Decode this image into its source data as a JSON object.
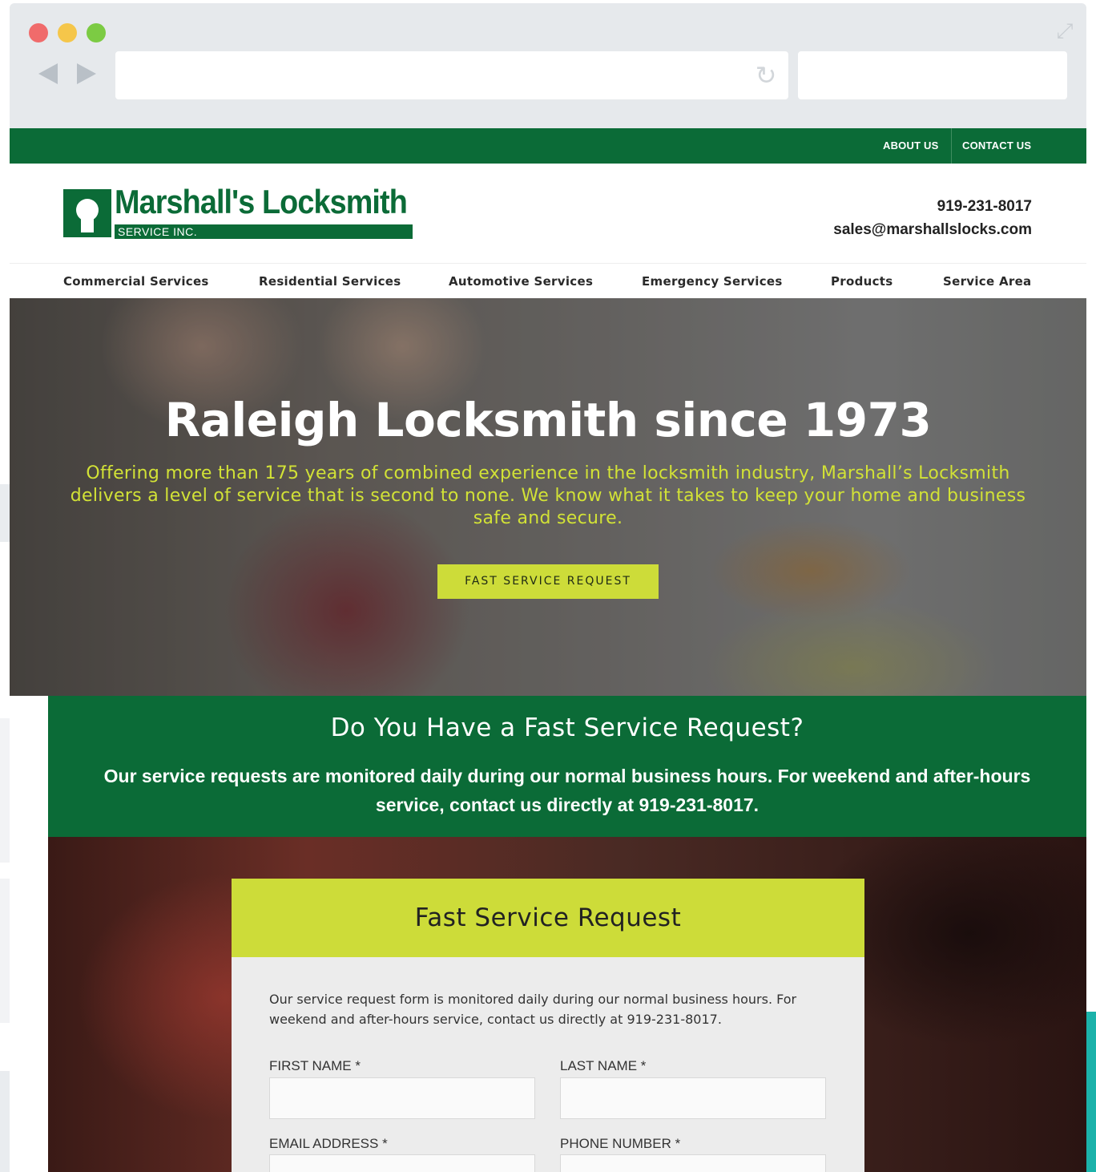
{
  "site": {
    "topbar": {
      "about": "ABOUT US",
      "contact": "CONTACT US"
    },
    "header": {
      "logo_name": "Marshall's Locksmith",
      "logo_sub": "SERVICE INC.",
      "phone": "919-231-8017",
      "email": "sales@marshallslocks.com"
    },
    "nav": [
      "Commercial Services",
      "Residential Services",
      "Automotive Services",
      "Emergency Services",
      "Products",
      "Service Area"
    ],
    "hero": {
      "title": "Raleigh Locksmith since 1973",
      "text": "Offering more than 175 years of combined experience in the locksmith industry, Marshall’s Locksmith delivers a level of service that is second to none. We know what it takes to keep your home and business safe and secure.",
      "button": "FAST SERVICE REQUEST"
    },
    "band": {
      "title": "Do You Have a Fast Service Request?",
      "text": "Our service requests are monitored daily during our normal business hours. For weekend and after-hours service, contact us directly at 919-231-8017."
    },
    "form": {
      "title": "Fast Service Request",
      "intro": "Our service request form is monitored daily during our normal business hours. For weekend and after-hours service, contact us directly at 919-231-8017.",
      "first_name": "FIRST NAME *",
      "last_name": "LAST NAME *",
      "email": "EMAIL ADDRESS *",
      "phone": "PHONE NUMBER *"
    }
  },
  "colors": {
    "brand_green": "#0b6b37",
    "accent_lime": "#cddc39"
  }
}
